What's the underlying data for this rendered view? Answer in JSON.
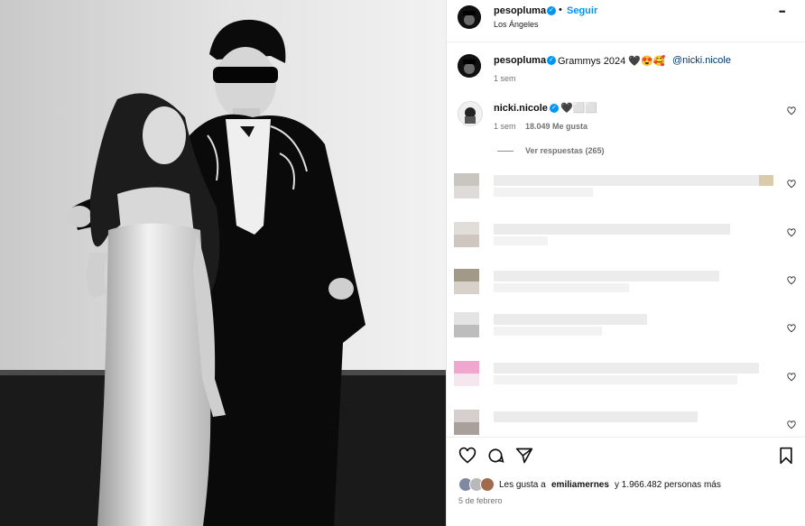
{
  "post": {
    "author": "pesopluma",
    "follow_label": "Seguir",
    "separator": "•",
    "location": "Los Ángeles",
    "more_label": "•••"
  },
  "caption": {
    "author": "pesopluma",
    "text": "Grammys 2024 🖤😍🥰",
    "mention": "@nicki.nicole",
    "time": "1 sem"
  },
  "reply": {
    "author": "nicki.nicole",
    "text": "🖤⬜⬜",
    "time": "1 sem",
    "likes": "18.049 Me gusta",
    "view_replies": "Ver respuestas (265)"
  },
  "footer": {
    "likes_prefix": "Les gusta a",
    "likes_user": "emiliamernes",
    "likes_suffix": "y 1.966.482 personas más",
    "date": "5 de febrero"
  },
  "colors": {
    "accent": "#0095f6",
    "meta": "#737373"
  }
}
